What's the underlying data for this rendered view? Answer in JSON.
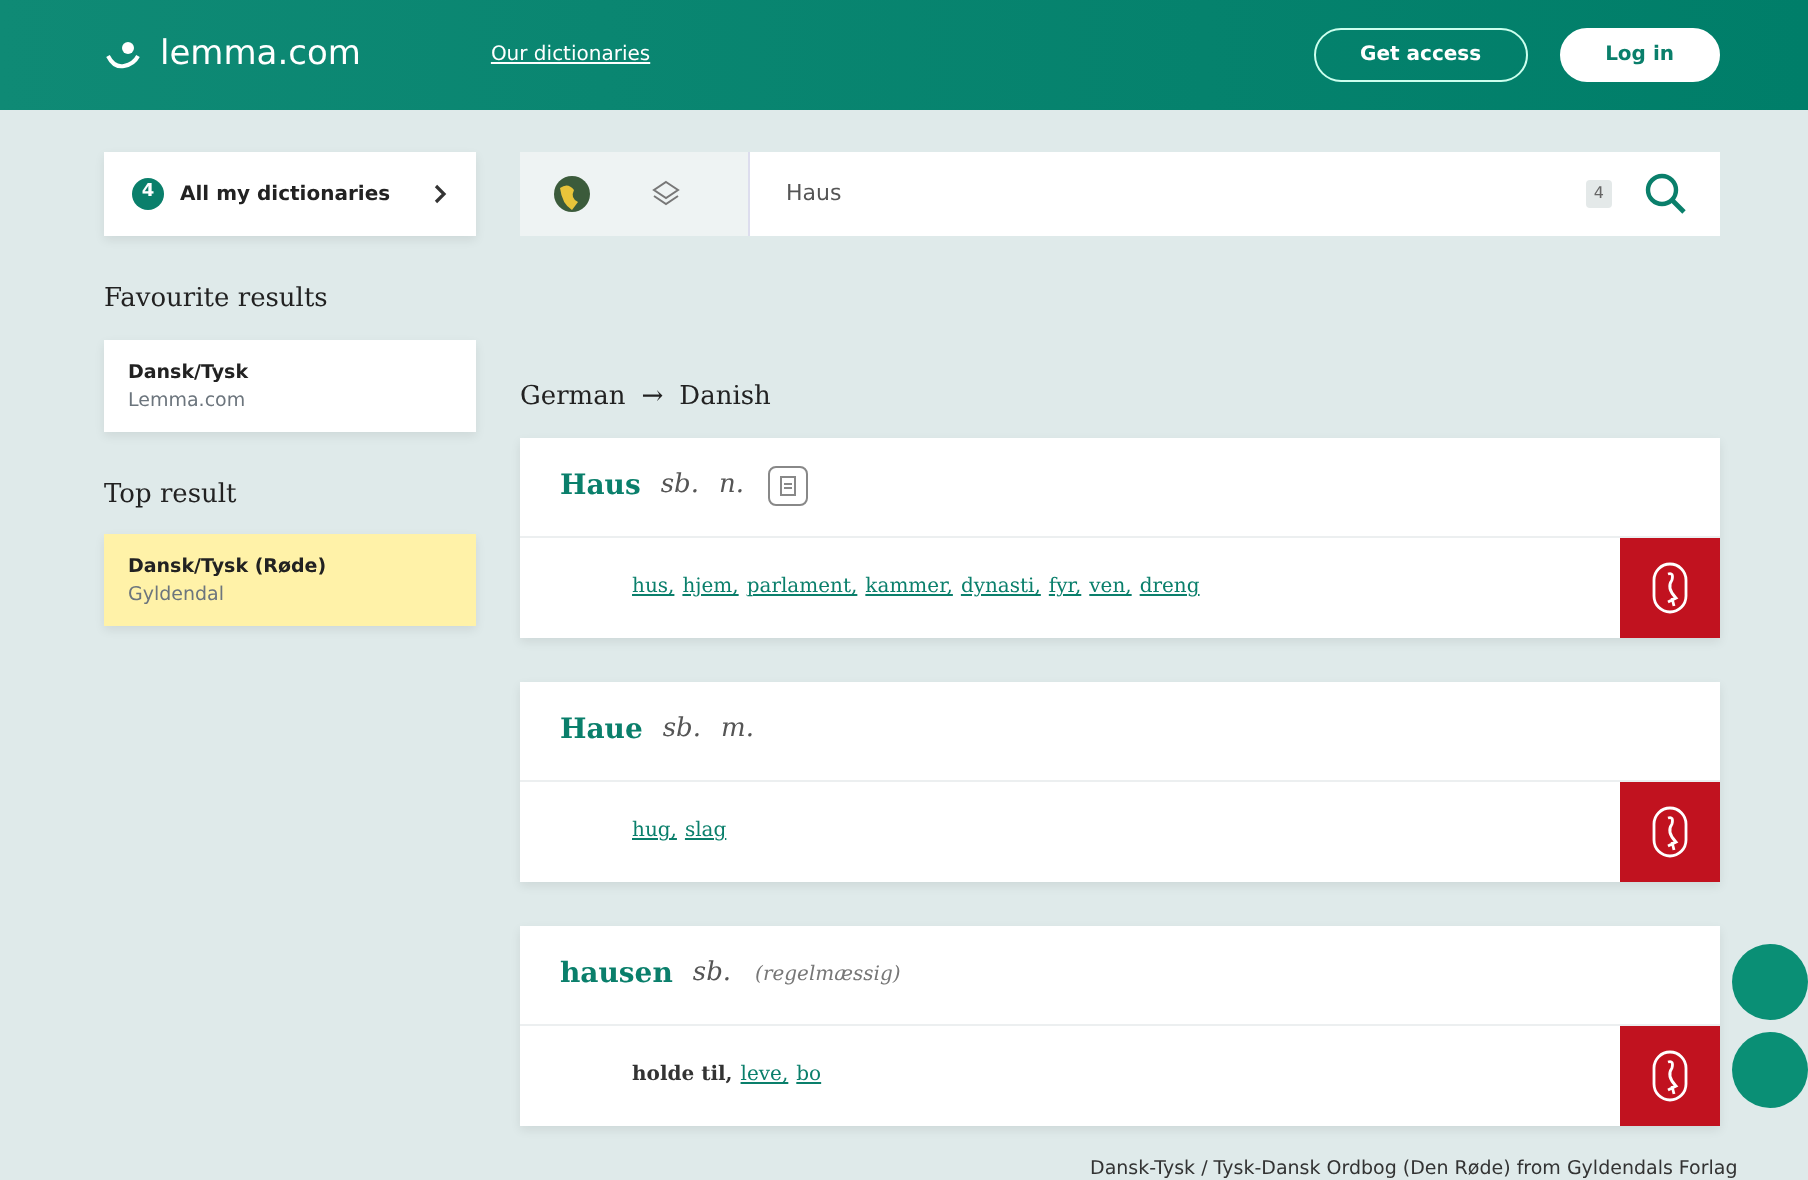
{
  "header": {
    "logo": "lemma.com",
    "nav_link": "Our dictionaries",
    "buttons": [
      {
        "label": "Get access",
        "kind": "outline"
      },
      {
        "label": "Log in",
        "kind": "solid"
      }
    ]
  },
  "sidebar": {
    "dictionaries": {
      "count": "4",
      "label": "All my dictionaries"
    },
    "favourites": {
      "title": "Favourite results",
      "items": [
        {
          "name": "Dansk/Tysk",
          "source": "Lemma.com",
          "selected": false
        }
      ]
    },
    "top": {
      "title": "Top result",
      "items": [
        {
          "name": "Dansk/Tysk (Røde)",
          "source": "Gyldendal",
          "selected": true
        }
      ]
    }
  },
  "search": {
    "value": "Haus",
    "key_hint": "4"
  },
  "direction": {
    "from": "German",
    "arrow": "→",
    "to": "Danish"
  },
  "entries": [
    {
      "headword": "Haus",
      "pos": "sb.",
      "gender": "n.",
      "has_doc": true,
      "translations": [
        {
          "text": "hus,",
          "link": true
        },
        {
          "text": "hjem,",
          "link": true
        },
        {
          "text": "parlament,",
          "link": true
        },
        {
          "text": "kammer,",
          "link": true
        },
        {
          "text": "dynasti,",
          "link": true
        },
        {
          "text": "fyr,",
          "link": true
        },
        {
          "text": "ven,",
          "link": true
        },
        {
          "text": "dreng",
          "link": true
        }
      ]
    },
    {
      "headword": "Haue",
      "pos": "sb.",
      "gender": "m.",
      "translations": [
        {
          "text": "hug,",
          "link": true
        },
        {
          "text": "slag",
          "link": true
        }
      ]
    },
    {
      "headword": "hausen",
      "pos": "sb.",
      "note": "(regelmæssig)",
      "translations": [
        {
          "text": "holde til,",
          "link": false
        },
        {
          "text": "leve,",
          "link": true
        },
        {
          "text": "bo",
          "link": true
        }
      ]
    }
  ],
  "footer": "Dansk-Tysk / Tysk-Dansk Ordbog (Den Røde) from Gyldendals Forlag"
}
